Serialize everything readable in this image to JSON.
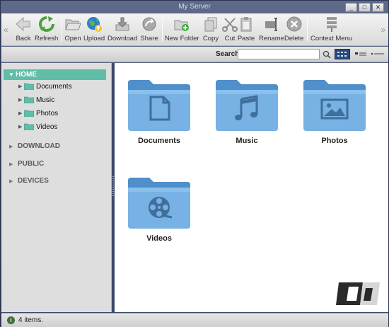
{
  "window": {
    "title": "My Server",
    "buttons": [
      "_",
      "□",
      "✕"
    ]
  },
  "toolbar": {
    "nav_left": "«",
    "nav_right": "»",
    "items": [
      {
        "label": "Back",
        "icon": "back-arrow-icon"
      },
      {
        "label": "Refresh",
        "icon": "refresh-icon"
      },
      {
        "label": "Open",
        "icon": "open-folder-icon"
      },
      {
        "label": "Upload",
        "icon": "upload-globe-icon"
      },
      {
        "label": "Download",
        "icon": "download-icon"
      },
      {
        "label": "Share",
        "icon": "share-icon"
      },
      {
        "label": "New Folder",
        "icon": "new-folder-icon"
      },
      {
        "label": "Copy",
        "icon": "copy-icon"
      },
      {
        "label": "Cut",
        "icon": "scissors-icon"
      },
      {
        "label": "Paste",
        "icon": "paste-icon"
      },
      {
        "label": "Rename",
        "icon": "rename-icon"
      },
      {
        "label": "Delete",
        "icon": "delete-icon"
      },
      {
        "label": "Context Menu",
        "icon": "context-menu-icon"
      }
    ]
  },
  "search": {
    "label": "Search",
    "value": "",
    "placeholder": ""
  },
  "sidebar": {
    "home": "HOME",
    "children": [
      "Documents",
      "Music",
      "Photos",
      "Videos"
    ],
    "categories": [
      "DOWNLOAD",
      "PUBLIC",
      "DEVICES"
    ]
  },
  "content": {
    "folders": [
      {
        "name": "Documents",
        "icon": "document-icon"
      },
      {
        "name": "Music",
        "icon": "music-note-icon"
      },
      {
        "name": "Photos",
        "icon": "photo-icon"
      },
      {
        "name": "Videos",
        "icon": "film-reel-icon"
      }
    ]
  },
  "status": {
    "text": "4 items."
  },
  "colors": {
    "selection": "#5fbda8",
    "folder_blue": "#6aa7dc",
    "frame": "#3a4766"
  }
}
